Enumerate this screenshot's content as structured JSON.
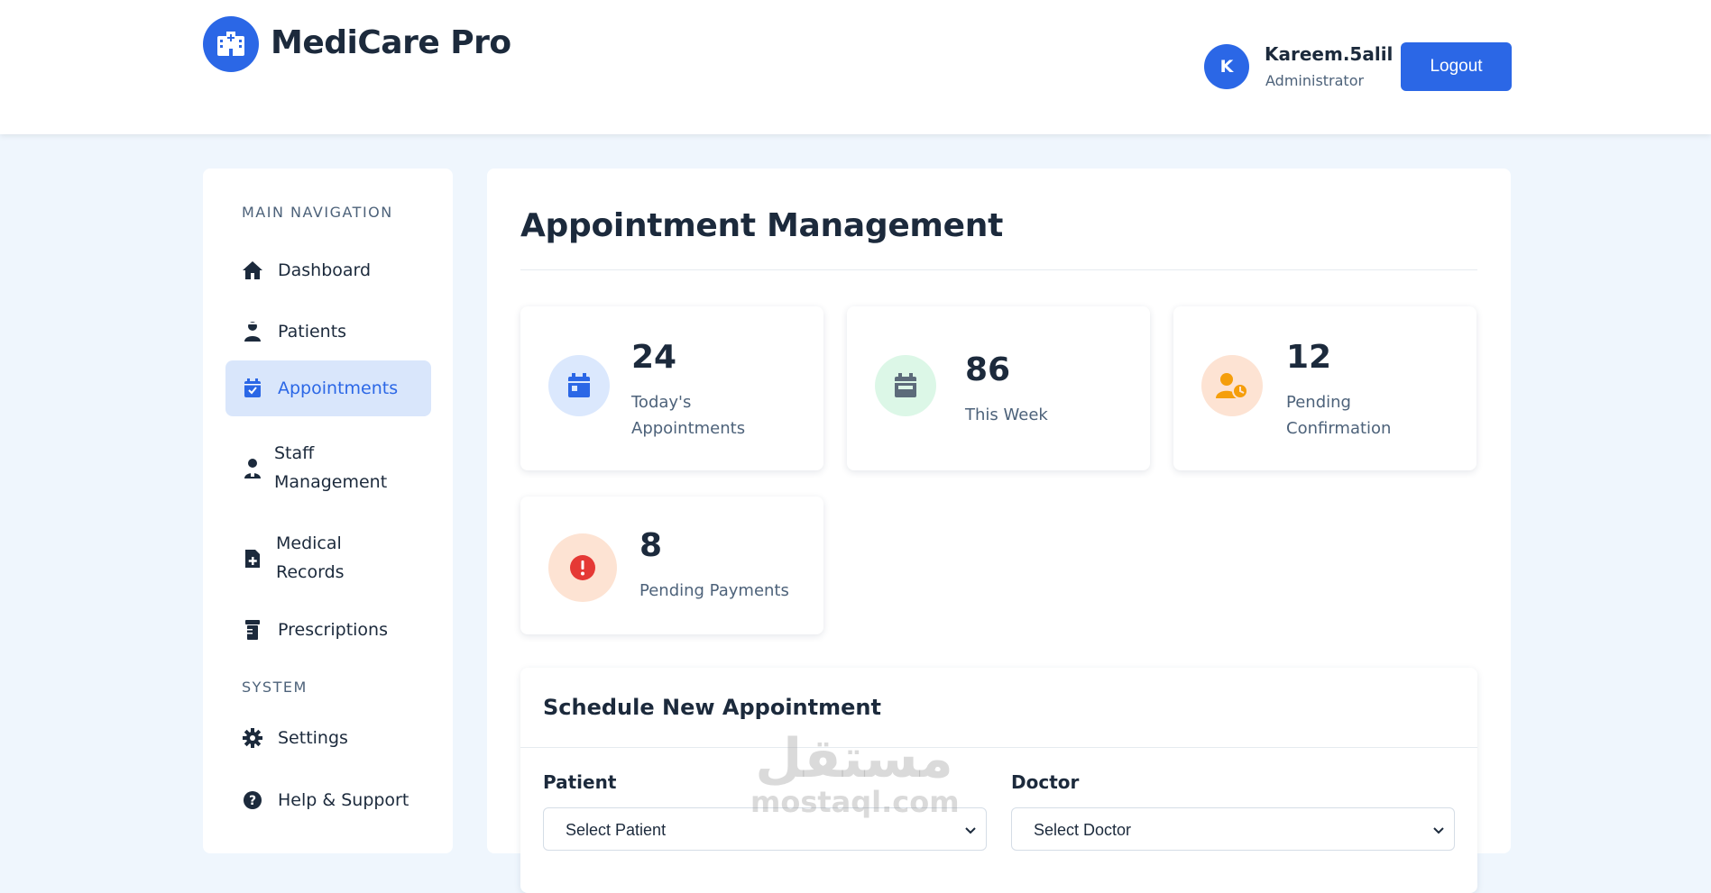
{
  "header": {
    "brand": "MediCare Pro",
    "user_initial": "K",
    "user_name": "Kareem.5alil",
    "user_role": "Administrator",
    "logout_label": "Logout"
  },
  "sidebar": {
    "main_heading": "MAIN NAVIGATION",
    "system_heading": "SYSTEM",
    "items": [
      {
        "label": "Dashboard",
        "icon": "home-icon"
      },
      {
        "label": "Patients",
        "icon": "user-injured-icon"
      },
      {
        "label": "Appointments",
        "icon": "calendar-check-icon",
        "active": true
      },
      {
        "label": "Staff\nManagement",
        "icon": "user-doctor-icon"
      },
      {
        "label": "Medical\nRecords",
        "icon": "file-medical-icon"
      },
      {
        "label": "Prescriptions",
        "icon": "prescription-bottle-icon"
      },
      {
        "label": "Settings",
        "icon": "gear-icon"
      },
      {
        "label": "Help & Support",
        "icon": "question-circle-icon"
      }
    ]
  },
  "main": {
    "title": "Appointment Management",
    "stats": [
      {
        "value": "24",
        "label": "Today's\nAppointments",
        "icon": "calendar-day-icon"
      },
      {
        "value": "86",
        "label": "This Week",
        "icon": "calendar-week-icon"
      },
      {
        "value": "12",
        "label": "Pending\nConfirmation",
        "icon": "user-clock-icon"
      },
      {
        "value": "8",
        "label": "Pending Payments",
        "icon": "exclamation-circle-icon"
      }
    ],
    "schedule": {
      "title": "Schedule New Appointment",
      "patient_label": "Patient",
      "patient_value": "Select Patient",
      "doctor_label": "Doctor",
      "doctor_value": "Select Doctor"
    }
  },
  "watermark": {
    "arabic": "مستقل",
    "latin": "mostaql.com"
  },
  "colors": {
    "primary": "#2b67e6",
    "background": "#eff6fd",
    "active_nav_bg": "#d9e6fb",
    "stat_blue_bg": "#dbe8fd",
    "stat_green_bg": "#dcf7e7",
    "stat_orange_bg": "#fde3d3",
    "stat_red_bg": "#fde3d3",
    "stat_red_icon": "#e53935",
    "stat_orange_icon": "#f59e0b",
    "stat_slate_icon": "#5c6b7a"
  }
}
